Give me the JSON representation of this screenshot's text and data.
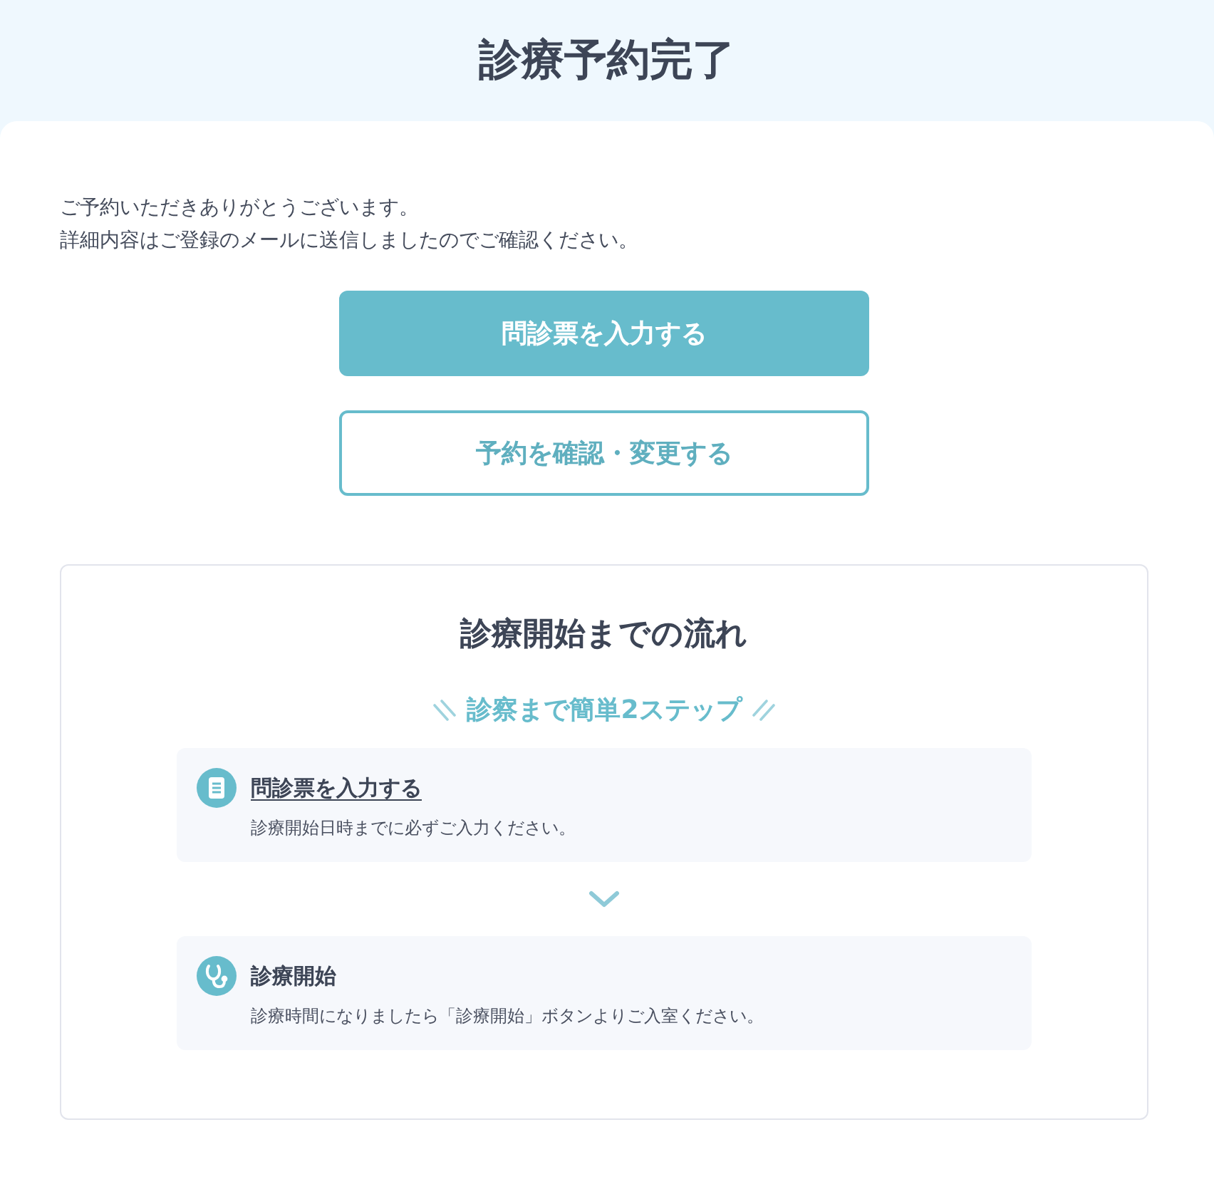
{
  "header": {
    "title": "診療予約完了"
  },
  "message": {
    "lines": [
      "ご予約いただきありがとうございます。",
      "詳細内容はご登録のメールに送信しましたのでご確認ください。"
    ]
  },
  "buttons": [
    {
      "label": "問診票を入力する",
      "kind": "primary"
    },
    {
      "label": "予約を確認・変更する",
      "kind": "secondary"
    }
  ],
  "flow": {
    "title": "診療開始までの流れ",
    "subtitle": "診察まで簡単2ステップ",
    "steps": [
      {
        "title": "問診票を入力する",
        "link": true,
        "description": "診療開始日時までに必ずご入力ください。"
      },
      {
        "title": "診療開始",
        "link": false,
        "description": "診療時間になりましたら「診療開始」ボタンよりご入室ください。"
      }
    ]
  }
}
